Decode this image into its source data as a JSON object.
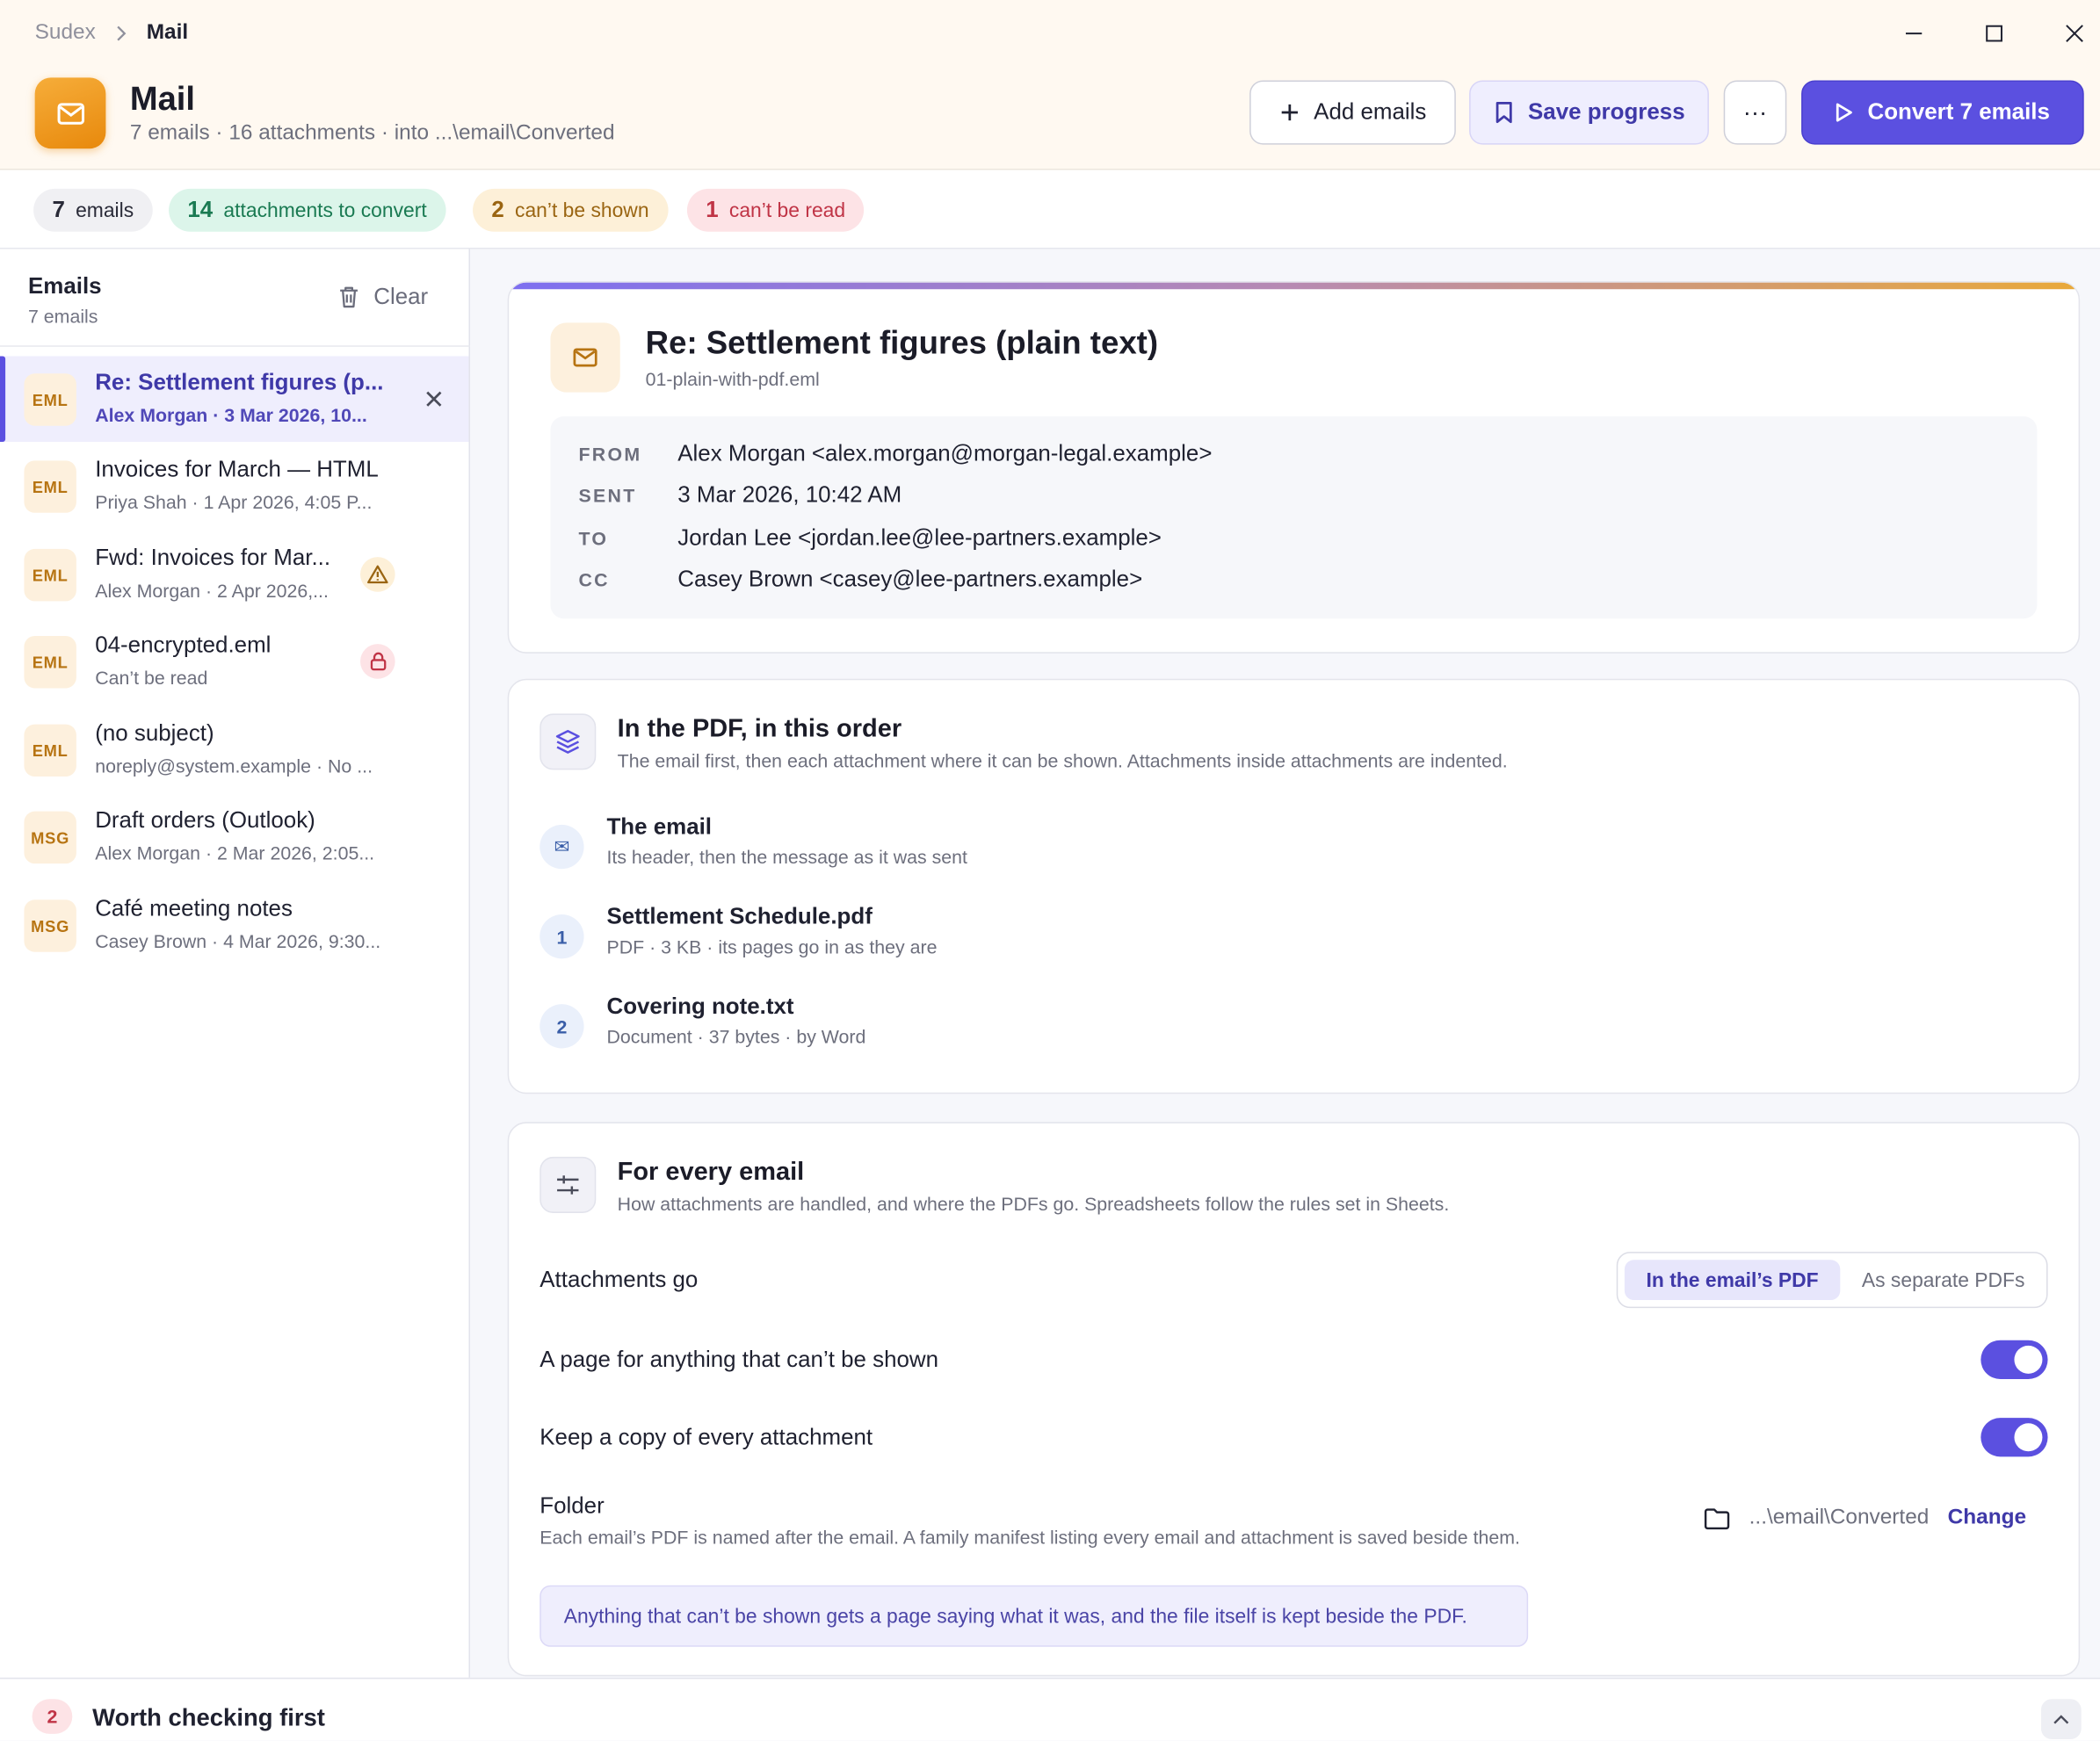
{
  "breadcrumb": {
    "root": "Sudex",
    "current": "Mail"
  },
  "app": {
    "title": "Mail",
    "subtitle": "7 emails · 16 attachments · into ...\\email\\Converted"
  },
  "toolbar": {
    "add_label": "Add emails",
    "save_label": "Save progress",
    "more_label": "···",
    "convert_label": "Convert 7 emails"
  },
  "chips": {
    "emails": {
      "count": "7",
      "label": "emails"
    },
    "convert": {
      "count": "14",
      "label": "attachments to convert"
    },
    "shown": {
      "count": "2",
      "label": "can’t be shown"
    },
    "read": {
      "count": "1",
      "label": "can’t be read"
    }
  },
  "sidebar": {
    "title": "Emails",
    "count": "7 emails",
    "clear_label": "Clear",
    "items": [
      {
        "badge": "EML",
        "title": "Re: Settlement figures (p...",
        "sub": "Alex Morgan · 3 Mar 2026, 10...",
        "selected": true
      },
      {
        "badge": "EML",
        "title": "Invoices for March — HTML",
        "sub": "Priya Shah · 1 Apr 2026, 4:05 P..."
      },
      {
        "badge": "EML",
        "title": "Fwd: Invoices for Mar...",
        "sub": "Alex Morgan · 2 Apr 2026,...",
        "flag": "warning-icon"
      },
      {
        "badge": "EML",
        "title": "04-encrypted.eml",
        "sub": "Can’t be read",
        "flag": "lock-icon"
      },
      {
        "badge": "EML",
        "title": "(no subject)",
        "sub": "noreply@system.example · No ..."
      },
      {
        "badge": "MSG",
        "title": "Draft orders (Outlook)",
        "sub": "Alex Morgan · 2 Mar 2026, 2:05..."
      },
      {
        "badge": "MSG",
        "title": "Café meeting notes",
        "sub": "Casey Brown · 4 Mar 2026, 9:30..."
      }
    ]
  },
  "email": {
    "subject": "Re: Settlement figures (plain text)",
    "filename": "01-plain-with-pdf.eml",
    "headers": [
      {
        "key": "FROM",
        "value": "Alex Morgan <alex.morgan@morgan-legal.example>"
      },
      {
        "key": "SENT",
        "value": "3 Mar 2026, 10:42 AM"
      },
      {
        "key": "TO",
        "value": "Jordan Lee <jordan.lee@lee-partners.example>"
      },
      {
        "key": "CC",
        "value": "Casey Brown <casey@lee-partners.example>"
      }
    ]
  },
  "order": {
    "title": "In the PDF, in this order",
    "subtitle": "The email first, then each attachment where it can be shown. Attachments inside attachments are indented.",
    "items": [
      {
        "marker": "✉",
        "title": "The email",
        "sub": "Its header, then the message as it was sent"
      },
      {
        "marker": "1",
        "title": "Settlement Schedule.pdf",
        "sub": "PDF · 3 KB · its pages go in as they are"
      },
      {
        "marker": "2",
        "title": "Covering note.txt",
        "sub": "Document · 37 bytes · by Word"
      }
    ]
  },
  "settings": {
    "title": "For every email",
    "subtitle": "How attachments are handled, and where the PDFs go. Spreadsheets follow the rules set in Sheets.",
    "attachments_label": "Attachments go",
    "seg_selected": "In the email’s PDF",
    "seg_other": "As separate PDFs",
    "page_label": "A page for anything that can’t be shown",
    "page_on": true,
    "copy_label": "Keep a copy of every attachment",
    "copy_on": true,
    "folder_label": "Folder",
    "folder_sub": "Each email’s PDF is named after the email. A family manifest listing every email and attachment is saved beside them.",
    "folder_path": "...\\email\\Converted",
    "change_label": "Change",
    "note": "Anything that can’t be shown gets a page saying what it was, and the file itself is kept beside the PDF."
  },
  "bottom": {
    "count": "2",
    "title": "Worth checking first"
  },
  "colors": {
    "accent": "#5b50e0",
    "brand": "#e8890c",
    "success": "#1a7a52",
    "warning": "#9a6512",
    "danger": "#c03446"
  }
}
